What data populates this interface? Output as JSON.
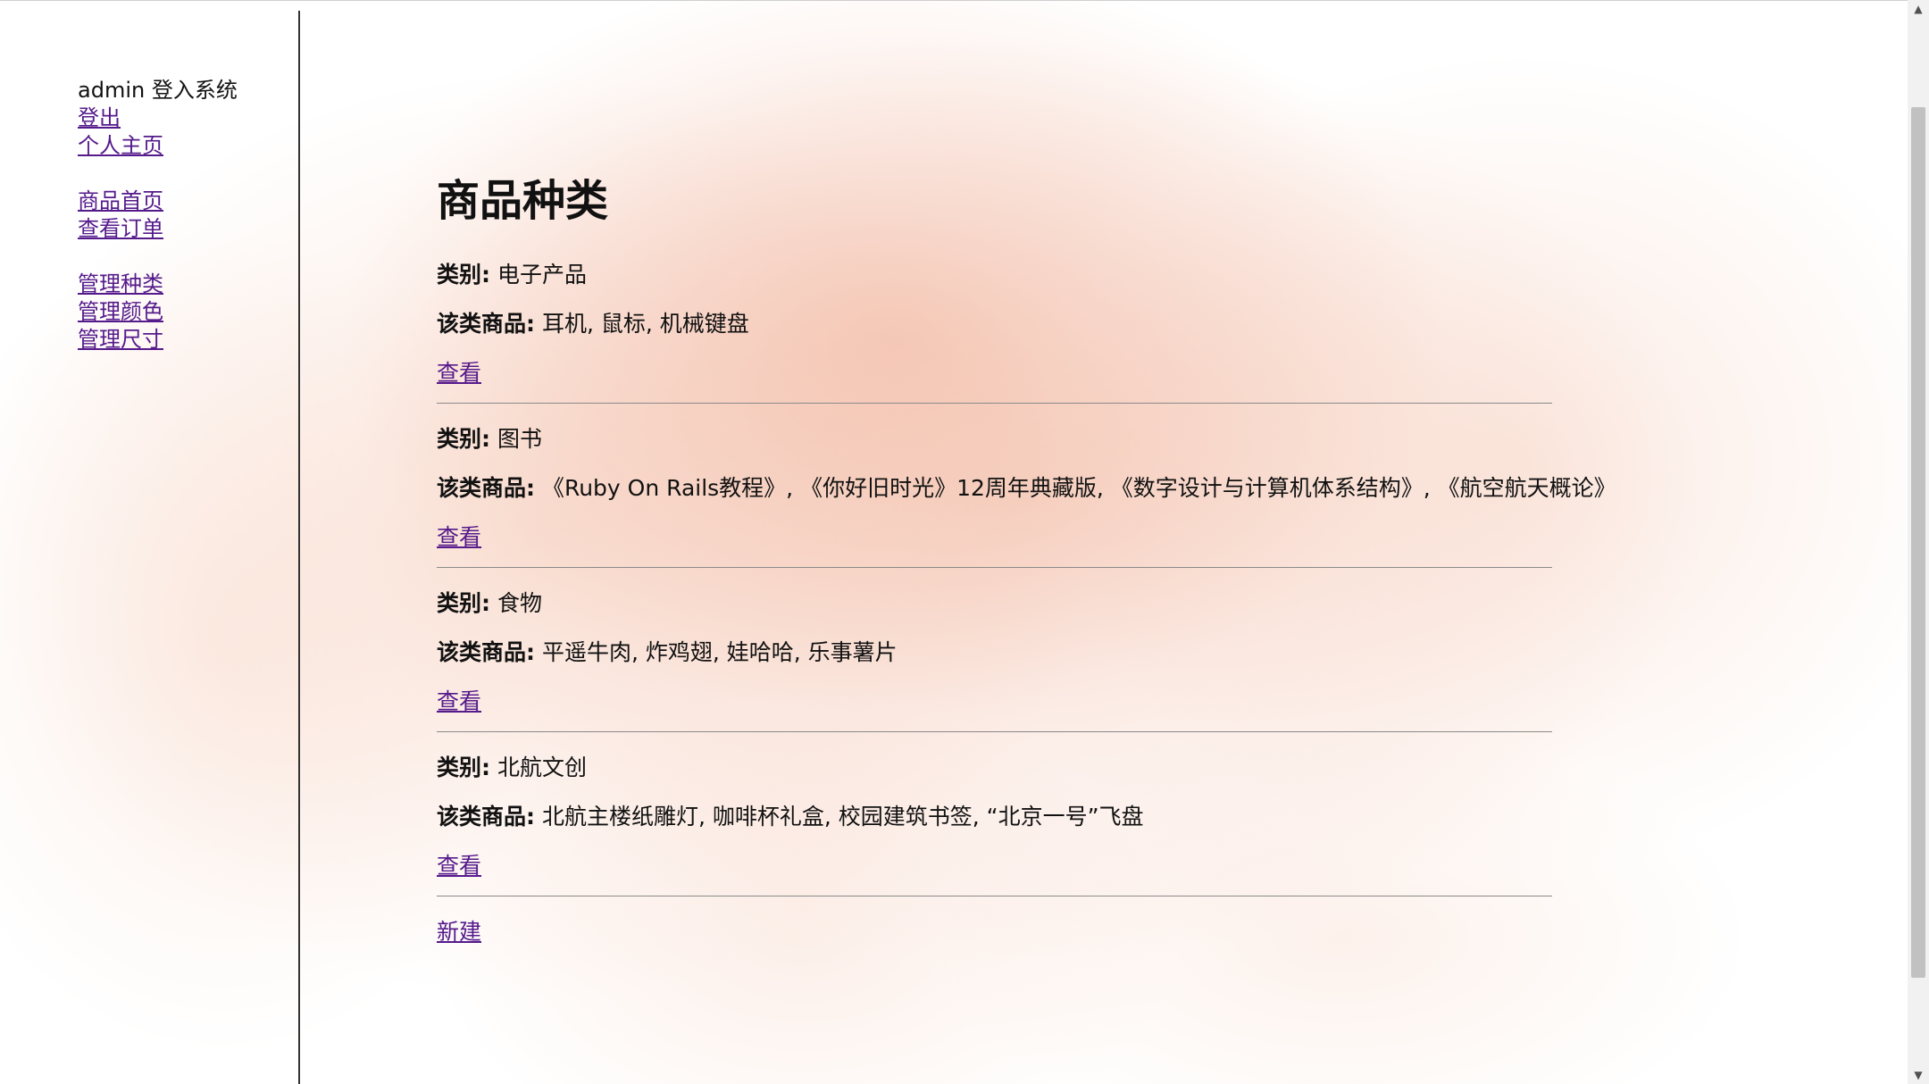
{
  "sidebar": {
    "user_status": "admin 登入系统",
    "logout": "登出",
    "profile": "个人主页",
    "product_home": "商品首页",
    "view_orders": "查看订单",
    "manage_categories": "管理种类",
    "manage_colors": "管理颜色",
    "manage_sizes": "管理尺寸"
  },
  "main": {
    "title": "商品种类",
    "category_label": "类别:",
    "products_label": "该类商品:",
    "view_link": "查看",
    "new_link": "新建",
    "categories": [
      {
        "name": "电子产品",
        "products": "耳机, 鼠标, 机械键盘"
      },
      {
        "name": "图书",
        "products": "《Ruby On Rails教程》, 《你好旧时光》12周年典藏版, 《数字设计与计算机体系结构》, 《航空航天概论》"
      },
      {
        "name": "食物",
        "products": "平遥牛肉, 炸鸡翅, 娃哈哈, 乐事薯片"
      },
      {
        "name": "北航文创",
        "products": "北航主楼纸雕灯, 咖啡杯礼盒, 校园建筑书签, “北京一号”飞盘"
      }
    ]
  },
  "scrollbar": {
    "up_arrow": "▲",
    "down_arrow": "▼"
  }
}
